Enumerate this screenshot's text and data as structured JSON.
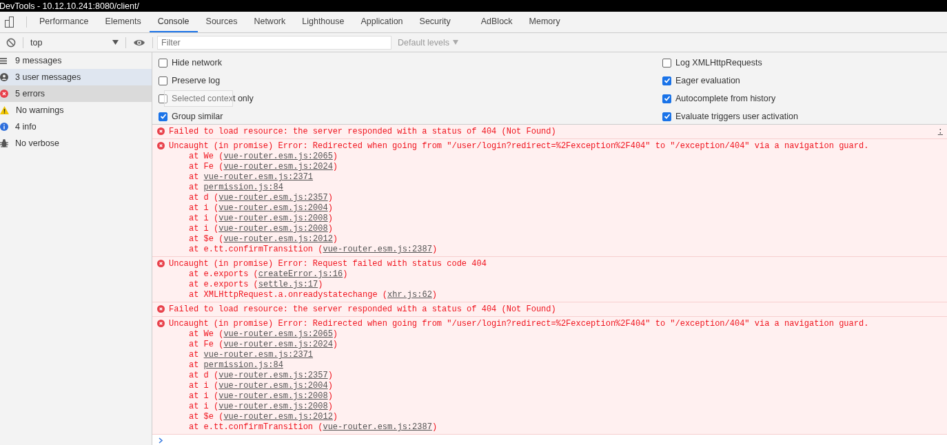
{
  "window": {
    "title": "DevTools - 10.12.10.241:8080/client/"
  },
  "tabs": [
    {
      "label": "Performance",
      "selected": false
    },
    {
      "label": "Elements",
      "selected": false
    },
    {
      "label": "Console",
      "selected": true
    },
    {
      "label": "Sources",
      "selected": false
    },
    {
      "label": "Network",
      "selected": false
    },
    {
      "label": "Lighthouse",
      "selected": false
    },
    {
      "label": "Application",
      "selected": false
    },
    {
      "label": "Security",
      "selected": false
    },
    {
      "label": "AdBlock",
      "selected": false
    },
    {
      "label": "Memory",
      "selected": false
    }
  ],
  "toolbar": {
    "context": "top",
    "filter": {
      "placeholder": "Filter"
    },
    "levels": "Default levels"
  },
  "sidebar": {
    "items": [
      {
        "kind": "all",
        "label": "9 messages",
        "selected": false,
        "hovered": false
      },
      {
        "kind": "user",
        "label": "3 user messages",
        "selected": true,
        "hovered": false
      },
      {
        "kind": "error",
        "label": "5 errors",
        "selected": false,
        "hovered": true
      },
      {
        "kind": "warning",
        "label": "No warnings",
        "selected": false,
        "hovered": false
      },
      {
        "kind": "info",
        "label": "4 info",
        "selected": false,
        "hovered": false
      },
      {
        "kind": "verbose",
        "label": "No verbose",
        "selected": false,
        "hovered": false
      }
    ]
  },
  "settings": {
    "left": [
      {
        "label": "Hide network",
        "checked": false
      },
      {
        "label": "Preserve log",
        "checked": false
      },
      {
        "label": "Selected context only",
        "checked": false
      },
      {
        "label": "Group similar",
        "checked": true
      }
    ],
    "right": [
      {
        "label": "Log XMLHttpRequests",
        "checked": false
      },
      {
        "label": "Eager evaluation",
        "checked": true
      },
      {
        "label": "Autocomplete from history",
        "checked": true
      },
      {
        "label": "Evaluate triggers user activation",
        "checked": true
      }
    ]
  },
  "messages": [
    {
      "kind": "error",
      "text": "Failed to load resource: the server responded with a status of 404 (Not Found)",
      "source": ":"
    },
    {
      "kind": "error",
      "text": "Uncaught (in promise) Error: Redirected when going from \"/user/login?redirect=%2Fexception%2F404\" to \"/exception/404\" via a navigation guard.",
      "frames": [
        {
          "prefix": "at We (",
          "link": "vue-router.esm.js:2065",
          "suffix": ")"
        },
        {
          "prefix": "at Fe (",
          "link": "vue-router.esm.js:2024",
          "suffix": ")"
        },
        {
          "prefix": "at ",
          "link": "vue-router.esm.js:2371"
        },
        {
          "prefix": "at ",
          "link": "permission.js:84"
        },
        {
          "prefix": "at d (",
          "link": "vue-router.esm.js:2357",
          "suffix": ")"
        },
        {
          "prefix": "at i (",
          "link": "vue-router.esm.js:2004",
          "suffix": ")"
        },
        {
          "prefix": "at i (",
          "link": "vue-router.esm.js:2008",
          "suffix": ")"
        },
        {
          "prefix": "at i (",
          "link": "vue-router.esm.js:2008",
          "suffix": ")"
        },
        {
          "prefix": "at $e (",
          "link": "vue-router.esm.js:2012",
          "suffix": ")"
        },
        {
          "prefix": "at e.tt.confirmTransition (",
          "link": "vue-router.esm.js:2387",
          "suffix": ")"
        }
      ]
    },
    {
      "kind": "error",
      "text": "Uncaught (in promise) Error: Request failed with status code 404",
      "frames": [
        {
          "prefix": "at e.exports (",
          "link": "createError.js:16",
          "suffix": ")"
        },
        {
          "prefix": "at e.exports (",
          "link": "settle.js:17",
          "suffix": ")"
        },
        {
          "prefix": "at XMLHttpRequest.a.onreadystatechange (",
          "link": "xhr.js:62",
          "suffix": ")"
        }
      ]
    },
    {
      "kind": "error",
      "text": "Failed to load resource: the server responded with a status of 404 (Not Found)"
    },
    {
      "kind": "error",
      "text": "Uncaught (in promise) Error: Redirected when going from \"/user/login?redirect=%2Fexception%2F404\" to \"/exception/404\" via a navigation guard.",
      "frames": [
        {
          "prefix": "at We (",
          "link": "vue-router.esm.js:2065",
          "suffix": ")"
        },
        {
          "prefix": "at Fe (",
          "link": "vue-router.esm.js:2024",
          "suffix": ")"
        },
        {
          "prefix": "at ",
          "link": "vue-router.esm.js:2371"
        },
        {
          "prefix": "at ",
          "link": "permission.js:84"
        },
        {
          "prefix": "at d (",
          "link": "vue-router.esm.js:2357",
          "suffix": ")"
        },
        {
          "prefix": "at i (",
          "link": "vue-router.esm.js:2004",
          "suffix": ")"
        },
        {
          "prefix": "at i (",
          "link": "vue-router.esm.js:2008",
          "suffix": ")"
        },
        {
          "prefix": "at i (",
          "link": "vue-router.esm.js:2008",
          "suffix": ")"
        },
        {
          "prefix": "at $e (",
          "link": "vue-router.esm.js:2012",
          "suffix": ")"
        },
        {
          "prefix": "at e.tt.confirmTransition (",
          "link": "vue-router.esm.js:2387",
          "suffix": ")"
        }
      ]
    }
  ]
}
